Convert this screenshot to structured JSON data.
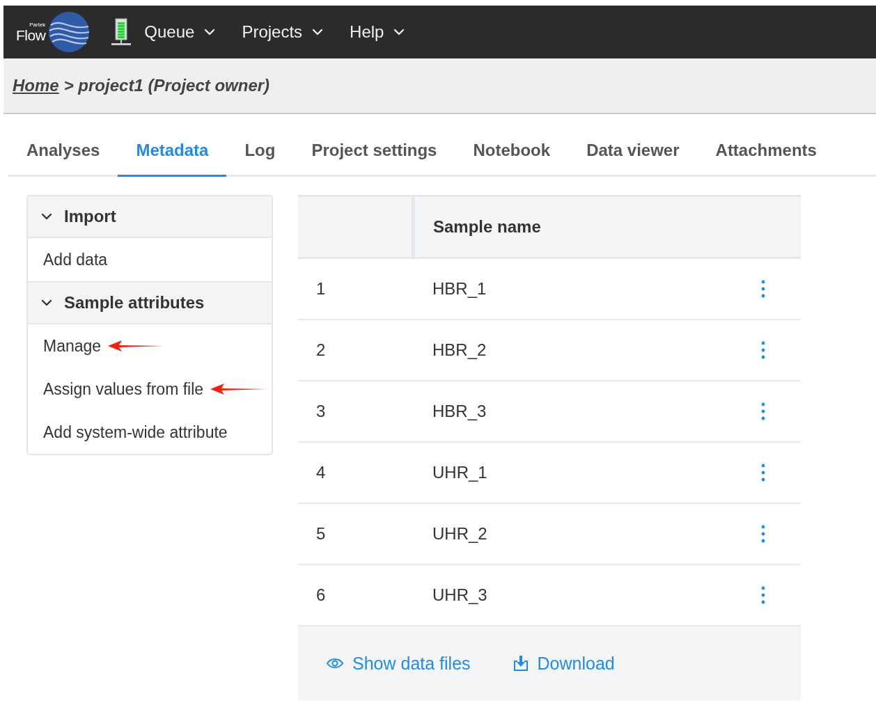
{
  "navbar": {
    "logo": {
      "small": "Partek",
      "big": "Flow"
    },
    "menus": [
      {
        "label": "Queue"
      },
      {
        "label": "Projects"
      },
      {
        "label": "Help"
      }
    ]
  },
  "breadcrumb": {
    "home": "Home",
    "rest": "> project1 (Project owner)"
  },
  "tabs": [
    {
      "label": "Analyses",
      "selected": false
    },
    {
      "label": "Metadata",
      "selected": true
    },
    {
      "label": "Log",
      "selected": false
    },
    {
      "label": "Project settings",
      "selected": false
    },
    {
      "label": "Notebook",
      "selected": false
    },
    {
      "label": "Data viewer",
      "selected": false
    },
    {
      "label": "Attachments",
      "selected": false
    }
  ],
  "sidebar": {
    "sections": [
      {
        "title": "Import",
        "expanded": true,
        "items": [
          {
            "label": "Add data",
            "annotated": false
          }
        ]
      },
      {
        "title": "Sample attributes",
        "expanded": true,
        "items": [
          {
            "label": "Manage",
            "annotated": true
          },
          {
            "label": "Assign values from file",
            "annotated": true
          },
          {
            "label": "Add system-wide attribute",
            "annotated": false
          }
        ]
      }
    ]
  },
  "table": {
    "columns": [
      "Sample name"
    ],
    "rows": [
      {
        "index": "1",
        "name": "HBR_1"
      },
      {
        "index": "2",
        "name": "HBR_2"
      },
      {
        "index": "3",
        "name": "HBR_3"
      },
      {
        "index": "4",
        "name": "UHR_1"
      },
      {
        "index": "5",
        "name": "UHR_2"
      },
      {
        "index": "6",
        "name": "UHR_3"
      }
    ],
    "footer": [
      {
        "kind": "eye",
        "label": "Show data files"
      },
      {
        "kind": "download",
        "label": "Download"
      }
    ]
  }
}
